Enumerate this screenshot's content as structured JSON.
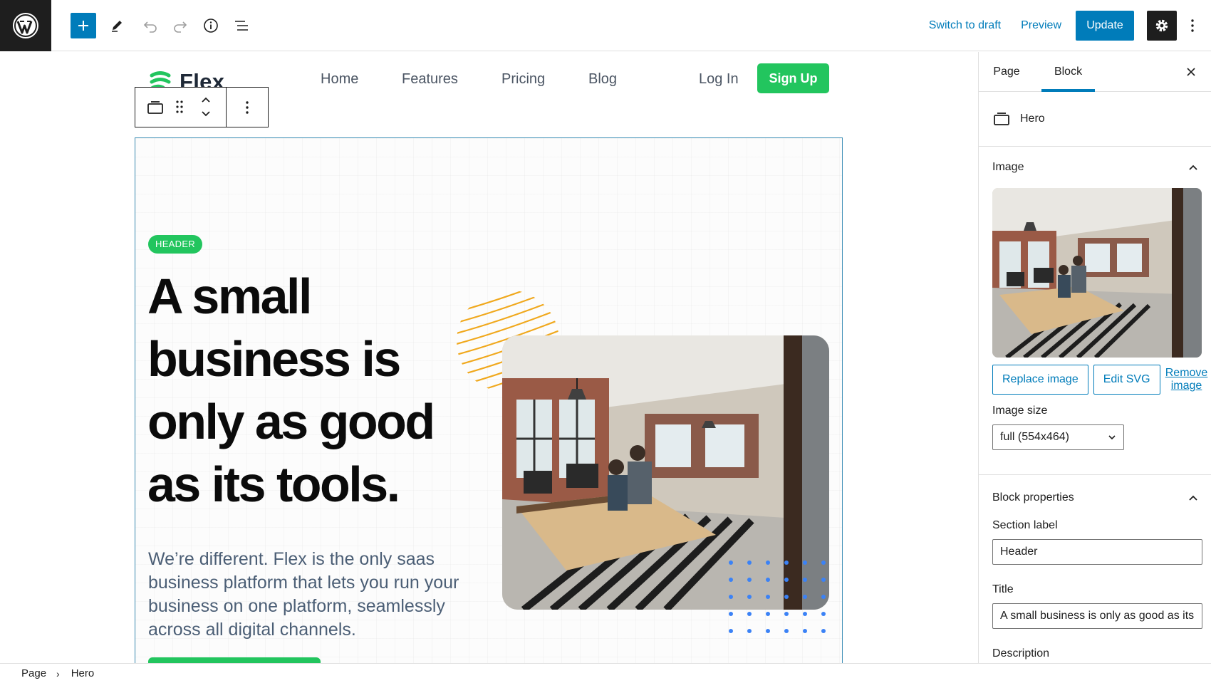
{
  "topbar": {
    "switch_to_draft": "Switch to draft",
    "preview": "Preview",
    "update": "Update"
  },
  "site": {
    "brand_name": "Flex",
    "nav": [
      "Home",
      "Features",
      "Pricing",
      "Blog"
    ],
    "login": "Log In",
    "signup": "Sign Up"
  },
  "hero": {
    "badge": "HEADER",
    "title": "A small business is only as good as its tools.",
    "description": "We’re different. Flex is the only saas business platform that lets you run your business on one platform, seamlessly across all digital channels."
  },
  "sidebar": {
    "tabs": [
      "Page",
      "Block"
    ],
    "active_tab": "Block",
    "block_name": "Hero",
    "image_panel": {
      "title": "Image",
      "replace": "Replace image",
      "edit_svg": "Edit SVG",
      "remove": "Remove image",
      "size_label": "Image size",
      "size_value": "full (554x464)"
    },
    "props_panel": {
      "title": "Block properties",
      "section_label": "Section label",
      "section_value": "Header",
      "title_label": "Title",
      "title_value": "A small business is only as good as its",
      "description_label": "Description"
    }
  },
  "breadcrumb": [
    "Page",
    "Hero"
  ],
  "colors": {
    "accent": "#007cba",
    "brand_green": "#22c55e",
    "dark": "#1e1e1e"
  }
}
